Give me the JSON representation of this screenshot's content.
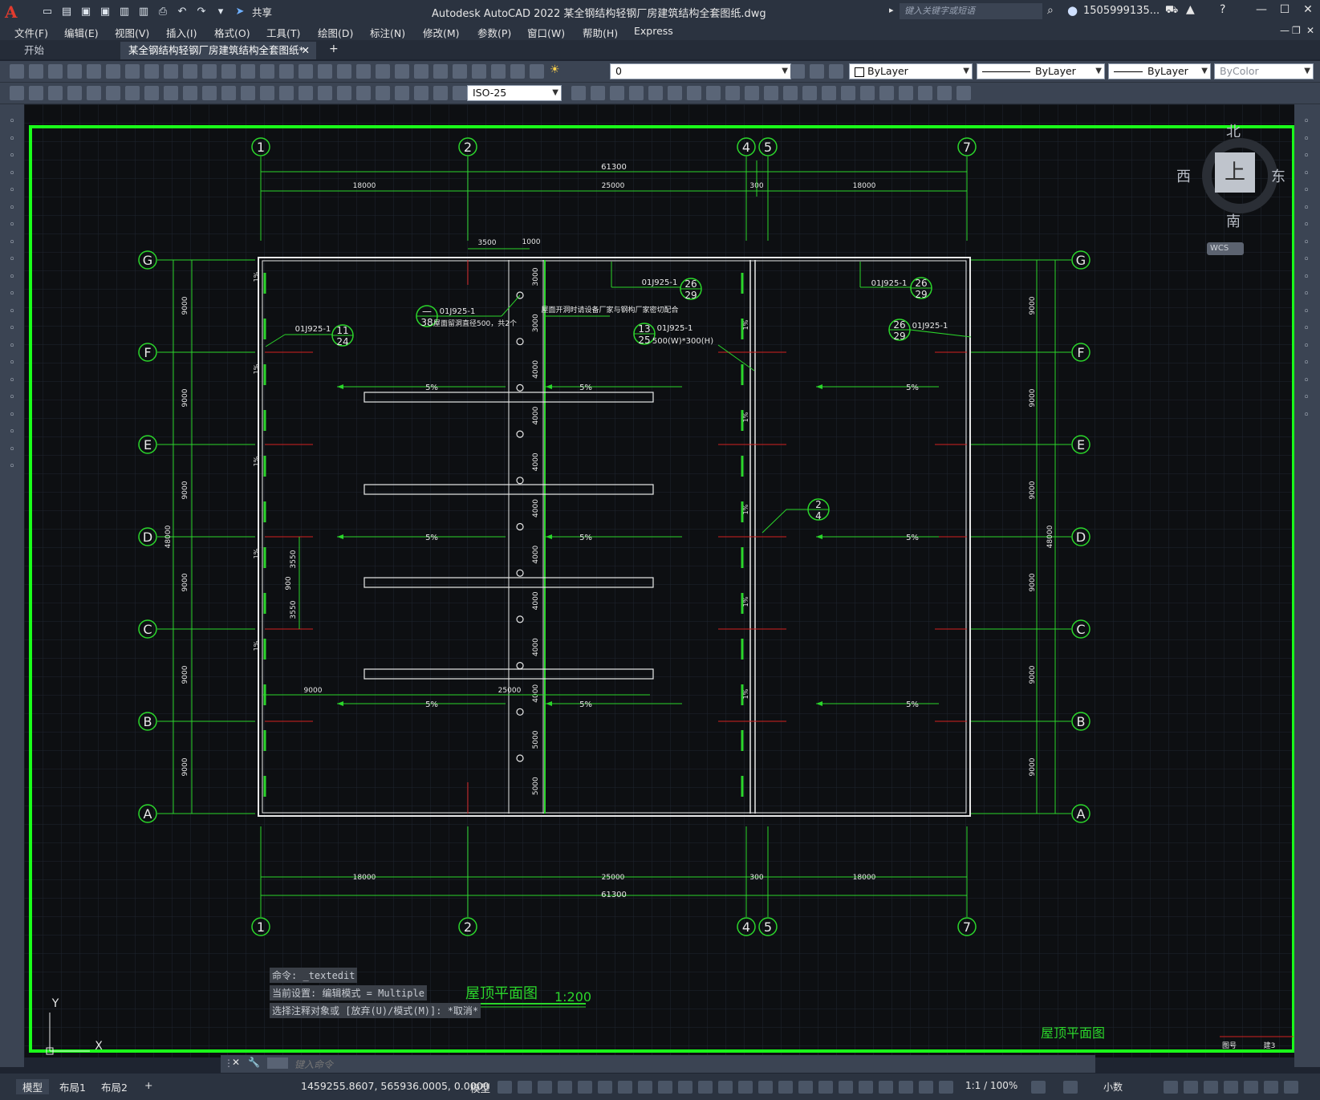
{
  "app": {
    "title": "Autodesk AutoCAD 2022    某全钢结构轻钢厂房建筑结构全套图纸.dwg",
    "share_label": "共享",
    "search_placeholder": "键入关键字或短语",
    "user": "1505999135..."
  },
  "menu": [
    "文件(F)",
    "编辑(E)",
    "视图(V)",
    "插入(I)",
    "格式(O)",
    "工具(T)",
    "绘图(D)",
    "标注(N)",
    "修改(M)",
    "参数(P)",
    "窗口(W)",
    "帮助(H)",
    "Express"
  ],
  "tabs": {
    "start": "开始",
    "active": "某全钢结构轻钢厂房建筑结构全套图纸*"
  },
  "toolbar": {
    "layer": "0",
    "dimstyle": "ISO-25",
    "color": "ByLayer",
    "linetype": "ByLayer",
    "lineweight": "ByLayer",
    "plotstyle": "ByColor"
  },
  "viewcube": {
    "north": "北",
    "south": "南",
    "west": "西",
    "east": "东",
    "face": "上",
    "wcs": "WCS"
  },
  "drawing": {
    "col_grid": [
      "1",
      "2",
      "4",
      "5",
      "7"
    ],
    "row_grid": [
      "G",
      "F",
      "E",
      "D",
      "C",
      "B",
      "A"
    ],
    "top_total": "61300",
    "top_dims": [
      "18000",
      "25000",
      "300",
      "18000"
    ],
    "bottom_total": "61300",
    "bottom_dims": [
      "18000",
      "25000",
      "300",
      "18000"
    ],
    "left_dims": [
      "9000",
      "9000",
      "9000",
      "9000",
      "9000",
      "9000"
    ],
    "right_dims": [
      "9000",
      "9000",
      "9000",
      "9000",
      "9000",
      "9000"
    ],
    "side_total": "48000",
    "mid_dims": [
      "3000",
      "3000",
      "4000",
      "4000",
      "4000",
      "4000",
      "4000",
      "4000",
      "4000",
      "4000",
      "5000",
      "5000"
    ],
    "top_small_dims": [
      "3500",
      "1000"
    ],
    "left_small_dims": [
      "3550",
      "900",
      "3550"
    ],
    "bottom_inner_dims": [
      "9000",
      "25000"
    ],
    "slope": "5%",
    "small_slope": "1%",
    "ref": "01J925-1",
    "ref_13": "01J925-1",
    "callout_11": "11",
    "callout_24": "24",
    "callout_26": "26",
    "callout_29": "29",
    "callout_13": "13",
    "callout_25": "25",
    "callout_dash": "—",
    "callout_38": "38",
    "callout_2": "2",
    "callout_4": "4",
    "note_hole": "屋面留洞直径500，共2个",
    "note_size": "500(W)*300(H)",
    "note_equipment": "屋面开洞时请设备厂家与钢构厂家密切配合",
    "title": "屋顶平面图",
    "scale": "1:200",
    "titleblock_name": "屋顶平面图",
    "titleblock_no": "图号",
    "titleblock_val": "建3",
    "ucs_y": "Y",
    "ucs_x": "X"
  },
  "command": {
    "history": [
      "命令: _textedit",
      "当前设置: 编辑模式 = Multiple",
      "选择注释对象或 [放弃(U)/模式(M)]: *取消*"
    ],
    "placeholder": "键入命令"
  },
  "status": {
    "tabs": [
      "模型",
      "布局1",
      "布局2"
    ],
    "coords": "1459255.8607, 565936.0005, 0.0000",
    "space": "模型",
    "scale": "1:1 / 100%",
    "units": "小数"
  }
}
